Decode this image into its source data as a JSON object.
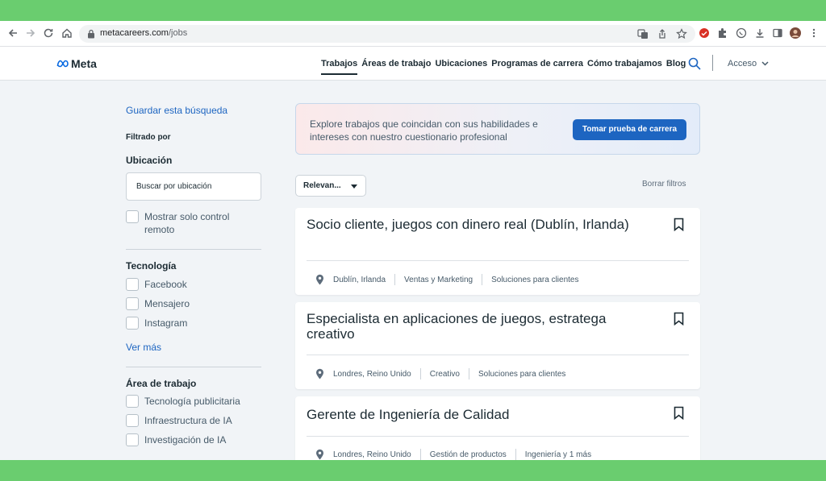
{
  "browser": {
    "url_host": "metacareers.com",
    "url_path": "/jobs"
  },
  "header": {
    "logo": "Meta",
    "nav": [
      "Trabajos",
      "Áreas de trabajo",
      "Ubicaciones",
      "Programas de carrera",
      "Cómo trabajamos",
      "Blog"
    ],
    "login": "Acceso"
  },
  "sidebar": {
    "save_search": "Guardar esta búsqueda",
    "filtered_by": "Filtrado por",
    "location": {
      "title": "Ubicación",
      "placeholder": "Buscar por ubicación",
      "remote_label": "Mostrar solo control remoto"
    },
    "technology": {
      "title": "Tecnología",
      "items": [
        "Facebook",
        "Mensajero",
        "Instagram"
      ],
      "see_more": "Ver más"
    },
    "work_area": {
      "title": "Área de trabajo",
      "items": [
        "Tecnología publicitaria",
        "Infraestructura de IA",
        "Investigación de IA"
      ]
    }
  },
  "main": {
    "banner": {
      "text": "Explore trabajos que coincidan con sus habilidades e intereses con nuestro cuestionario profesional",
      "button": "Tomar prueba de carrera"
    },
    "sort": "Relevan...",
    "clear_filters": "Borrar filtros",
    "jobs": [
      {
        "title": "Socio cliente, juegos con dinero real (Dublín, Irlanda)",
        "location": "Dublín, Irlanda",
        "team": "Ventas y Marketing",
        "sub_team": "Soluciones para clientes"
      },
      {
        "title": "Especialista en aplicaciones de juegos, estratega creativo",
        "location": "Londres, Reino Unido",
        "team": "Creativo",
        "sub_team": "Soluciones para clientes"
      },
      {
        "title": "Gerente de Ingeniería de Calidad",
        "location": "Londres, Reino Unido",
        "team": "Gestión de productos",
        "sub_team": "Ingeniería y 1 más"
      }
    ]
  },
  "colors": {
    "accent": "#1d65c1",
    "frame": "#6acd6f",
    "page_bg": "#f1f4f7"
  }
}
